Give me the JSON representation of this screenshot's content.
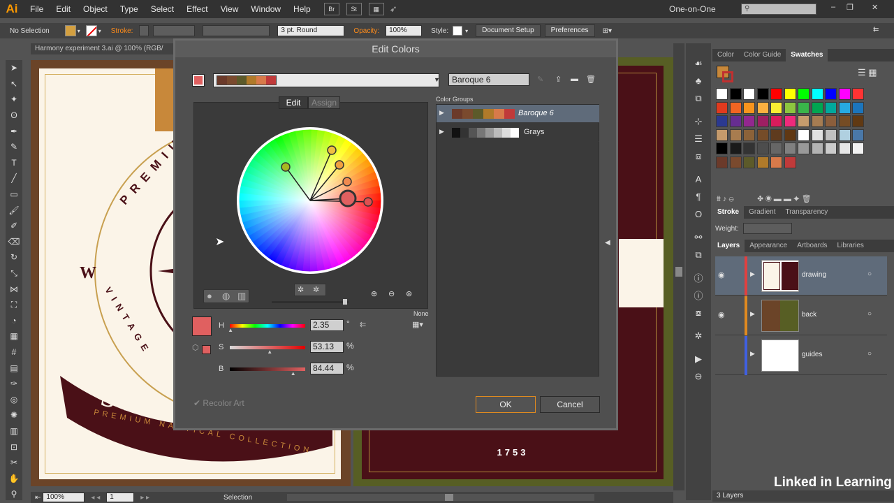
{
  "app": {
    "logo": "Ai"
  },
  "menubar": {
    "items": [
      "File",
      "Edit",
      "Object",
      "Type",
      "Select",
      "Effect",
      "View",
      "Window",
      "Help"
    ],
    "icons": {
      "br": "Br",
      "st": "St"
    },
    "workspace": "One-on-One",
    "window_controls": {
      "minimize": "–",
      "restore": "❐",
      "close": "✕"
    }
  },
  "controlbar": {
    "selection": "No Selection",
    "stroke_label": "Stroke:",
    "brush": "3 pt. Round",
    "opacity_label": "Opacity:",
    "opacity": "100%",
    "style_label": "Style:",
    "document_setup": "Document Setup",
    "preferences": "Preferences"
  },
  "document": {
    "tab": "Harmony experiment 3.ai @ 100% (RGB/"
  },
  "artwork": {
    "arc_text": "PREMIUM",
    "vintage": "VINTAGE",
    "letter_w": "W",
    "banner": "SEA",
    "collection": "PREMIUM NAUTICAL COLLECTION",
    "year": "1753"
  },
  "dialog": {
    "title": "Edit Colors",
    "group_name": "Baroque 6",
    "tabs": {
      "edit": "Edit",
      "assign": "Assign"
    },
    "color_groups_label": "Color Groups",
    "color_groups": [
      {
        "name": "Baroque 6",
        "colors": [
          "#6b3a2a",
          "#7a4a2e",
          "#5c5a2a",
          "#b07a2a",
          "#d87a4a",
          "#c03a3a"
        ]
      },
      {
        "name": "Grays",
        "colors": [
          "#111111",
          "#333333",
          "#555555",
          "#777777",
          "#999999",
          "#bbbbbb",
          "#dddddd",
          "#ffffff"
        ]
      }
    ],
    "none_label": "None",
    "hsb": [
      {
        "label": "H",
        "value": "2.35",
        "unit": "°",
        "fraction": 0.01
      },
      {
        "label": "S",
        "value": "53.13",
        "unit": "%",
        "fraction": 0.53
      },
      {
        "label": "B",
        "value": "84.44",
        "unit": "%",
        "fraction": 0.84
      }
    ],
    "recolor_art": "Recolor Art",
    "ok": "OK",
    "cancel": "Cancel",
    "active_color": "#e06060"
  },
  "panels": {
    "top_tabs": [
      "Color",
      "Color Guide",
      "Swatches"
    ],
    "stroke_tabs": [
      "Stroke",
      "Gradient",
      "Transparency"
    ],
    "weight_label": "Weight:",
    "layer_tabs": [
      "Layers",
      "Appearance",
      "Artboards",
      "Libraries"
    ],
    "layers": [
      {
        "name": "drawing",
        "color": "#e04040"
      },
      {
        "name": "back",
        "color": "#e08a20"
      },
      {
        "name": "guides",
        "color": "#4060e0"
      }
    ],
    "layers_count": "3 Layers"
  },
  "statusbar": {
    "zoom": "100%",
    "page": "1",
    "tool": "Selection"
  },
  "watermark": "Linked in Learning",
  "swatches": {
    "row1": [
      "#ffffff",
      "#000000",
      "#ffffff",
      "#000000",
      "#ff0000",
      "#ffff00",
      "#00ff00",
      "#00ffff",
      "#0000ff",
      "#ff00ff",
      "#ff3333"
    ],
    "row2": [
      "#e03a1e",
      "#f26522",
      "#f7941d",
      "#fbb040",
      "#f9ed32",
      "#8dc63f",
      "#39b54a",
      "#00a651",
      "#00a99d",
      "#27aae1",
      "#1c75bc"
    ],
    "row3": [
      "#2b3990",
      "#662d91",
      "#92278f",
      "#9e1f63",
      "#da1c5c",
      "#ee2a7b",
      "#c69c6d",
      "#a67c52",
      "#8b5e3c",
      "#754c24",
      "#603913"
    ],
    "row4": [
      "#c49a6c",
      "#a87c4f",
      "#8c6239",
      "#754c29",
      "#5f3b1e",
      "#603813",
      "#ffffff",
      "#e0e0e0",
      "#c0c0c0",
      "#b0d0e0",
      "#4a78a8"
    ],
    "row5": [
      "#000000",
      "#1a1a1a",
      "#333333",
      "#4d4d4d",
      "#666666",
      "#808080",
      "#999999",
      "#b3b3b3",
      "#cccccc",
      "#e6e6e6",
      "#f2f2f2"
    ],
    "row6": [
      "#6b3a2a",
      "#7a4a2e",
      "#5c5a2a",
      "#b07a2a",
      "#d87a4a",
      "#c03a3a"
    ]
  }
}
